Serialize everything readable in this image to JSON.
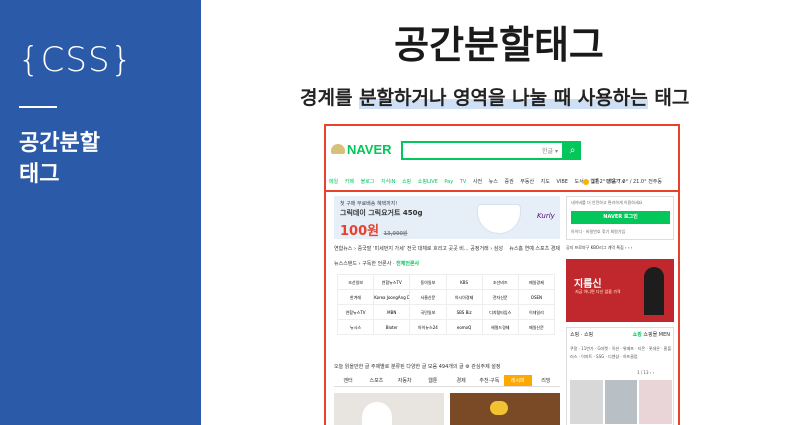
{
  "sidebar": {
    "tag": "{CSS}",
    "title_line1": "공간분할",
    "title_line2": "태그"
  },
  "main": {
    "title": "공간분할태그",
    "subtitle_pre": "경계를 ",
    "subtitle_hl": "분할하거나 영역을 나눌 때 사용하는",
    "subtitle_post": " 태그"
  },
  "naver": {
    "logo": "NAVER",
    "search_hint": "한글 ▾",
    "search_icon": "search-icon",
    "nav_green": [
      "메일",
      "카페",
      "블로그",
      "지식iN",
      "쇼핑",
      "쇼핑LIVE",
      "Pay",
      "TV"
    ],
    "nav_dark": [
      "사전",
      "뉴스",
      "증권",
      "부동산",
      "지도",
      "VIBE",
      "도서",
      "웹툰",
      "더보기 ∨"
    ],
    "weather": "17.2° 맑음  7.0° / 21.0°  전주동",
    "ad": {
      "line1": "첫 구매 무료배송 혜택까지!",
      "line2": "그릭데이 그릭요거트 450g",
      "price": "100원",
      "original": "13,000원",
      "brand": "Kurly"
    },
    "news_line": "연합뉴스 ›  중국발 ‘미세먼지 가세’ 전국 대체로 흐리고 곳곳 비... 공정거래 › 삼성",
    "news_right": "뉴스홈  연예  스포츠  경제",
    "newsstand": {
      "label": "뉴스스탠드 ›",
      "sub": "구독한 언론사 ·",
      "bold": "전체언론사"
    },
    "press": [
      "조선일보",
      "연합뉴스TV",
      "동아일보",
      "KBS",
      "조선비즈",
      "매일경제",
      "한겨레",
      "Korea JoongAng Daily",
      "서울신문",
      "아시아경제",
      "전자신문",
      "OSEN",
      "연합뉴스TV",
      "MBN",
      "국민일보",
      "SBS Biz",
      "디지털타임스",
      "이데일리",
      "뉴시스",
      "Bloter",
      "아이뉴스24",
      "eomoQ",
      "헤럴드경제",
      "매일신문"
    ],
    "shopping_head": "오늘 읽을만한 글  주제별로 분류된 다양한 글 모음   494개의 글  ⚙ 관심주제 설정",
    "tabs": [
      "엔터",
      "스포츠",
      "자동차",
      "웹툰",
      "경제",
      "추천·구독",
      "레시피",
      "리빙"
    ],
    "active_tab": "레시피",
    "login": {
      "hint": "네이버를 더 안전하고 편리하게 이용하세요",
      "button": "NAVER 로그인",
      "links": "아이디 · 비밀번호 찾기   회원가입"
    },
    "notice": "공지  프로야구 KBO리그 개막 특집 ›  ‹ ›",
    "banner": {
      "title": "지름신",
      "sub": "지금 아니면 다신 없을 가격"
    },
    "shopbox": {
      "head": "쇼핑 · 쇼핑",
      "tab_on": "쇼핑",
      "tab2": "쇼핑몰",
      "tab3": "MEN",
      "cats": "쿠팡 · 11번가 · G마켓 · 옥션 · 위메프 · 티몬 · 롯데온 · 홈플러스 · 이마트 · SSG · 디앤샵 · 하프클럽",
      "page": "1 / 13  ‹ ›"
    }
  }
}
